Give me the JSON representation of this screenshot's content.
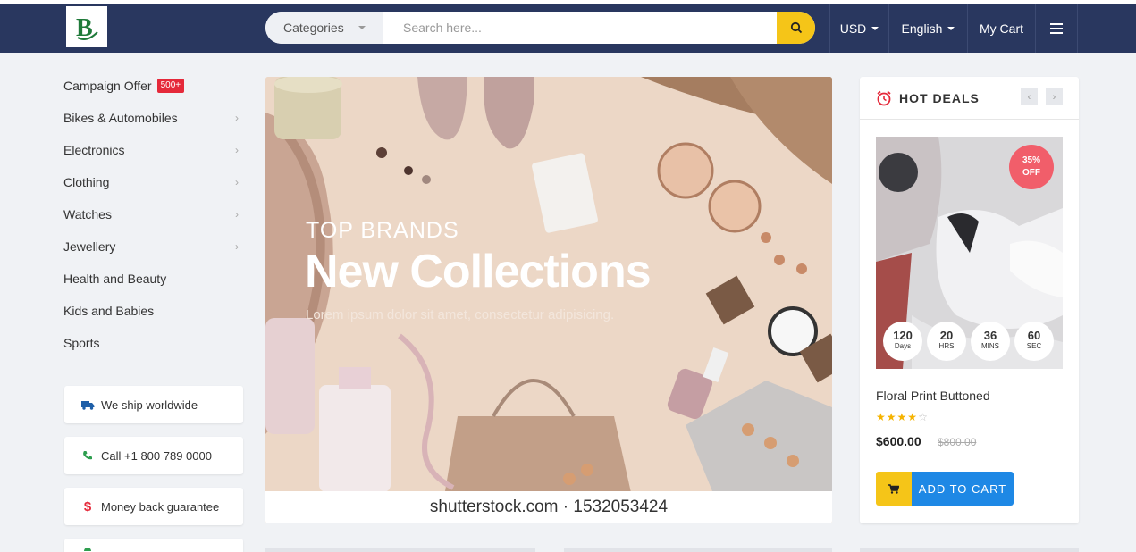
{
  "header": {
    "logo_text": "B",
    "categories_label": "Categories",
    "search_placeholder": "Search here...",
    "currency": "USD",
    "language": "English",
    "cart_label": "My Cart"
  },
  "sidebar": {
    "categories": [
      {
        "label": "Campaign Offer",
        "badge": "500+",
        "has_arrow": false
      },
      {
        "label": "Bikes & Automobiles",
        "has_arrow": true
      },
      {
        "label": "Electronics",
        "has_arrow": true
      },
      {
        "label": "Clothing",
        "has_arrow": true
      },
      {
        "label": "Watches",
        "has_arrow": true
      },
      {
        "label": "Jewellery",
        "has_arrow": true
      },
      {
        "label": "Health and Beauty",
        "has_arrow": false
      },
      {
        "label": "Kids and Babies",
        "has_arrow": false
      },
      {
        "label": "Sports",
        "has_arrow": false
      }
    ],
    "services": [
      {
        "label": "We ship worldwide",
        "icon": "truck-icon"
      },
      {
        "label": "Call +1 800 789 0000",
        "icon": "phone-icon"
      },
      {
        "label": "Money back guarantee",
        "icon": "dollar-icon"
      }
    ]
  },
  "hero": {
    "eyebrow": "TOP BRANDS",
    "title": "New Collections",
    "subtitle": "Lorem ipsum dolor sit amet, consectetur adipisicing.",
    "watermark": "shutterstock.com · 1532053424"
  },
  "hot_deals": {
    "title": "HOT DEALS",
    "discount_line1": "35%",
    "discount_line2": "OFF",
    "timer": [
      {
        "value": "120",
        "unit": "Days"
      },
      {
        "value": "20",
        "unit": "HRS"
      },
      {
        "value": "36",
        "unit": "MINS"
      },
      {
        "value": "60",
        "unit": "SEC"
      }
    ],
    "product_name": "Floral Print Buttoned",
    "rating": 4,
    "rating_max": 5,
    "price": "$600.00",
    "old_price": "$800.00",
    "add_to_cart": "ADD TO CART"
  },
  "colors": {
    "header_bg": "#29375f",
    "accent_yellow": "#f5c518",
    "button_blue": "#1e88e5",
    "badge_red": "#e5293a"
  }
}
